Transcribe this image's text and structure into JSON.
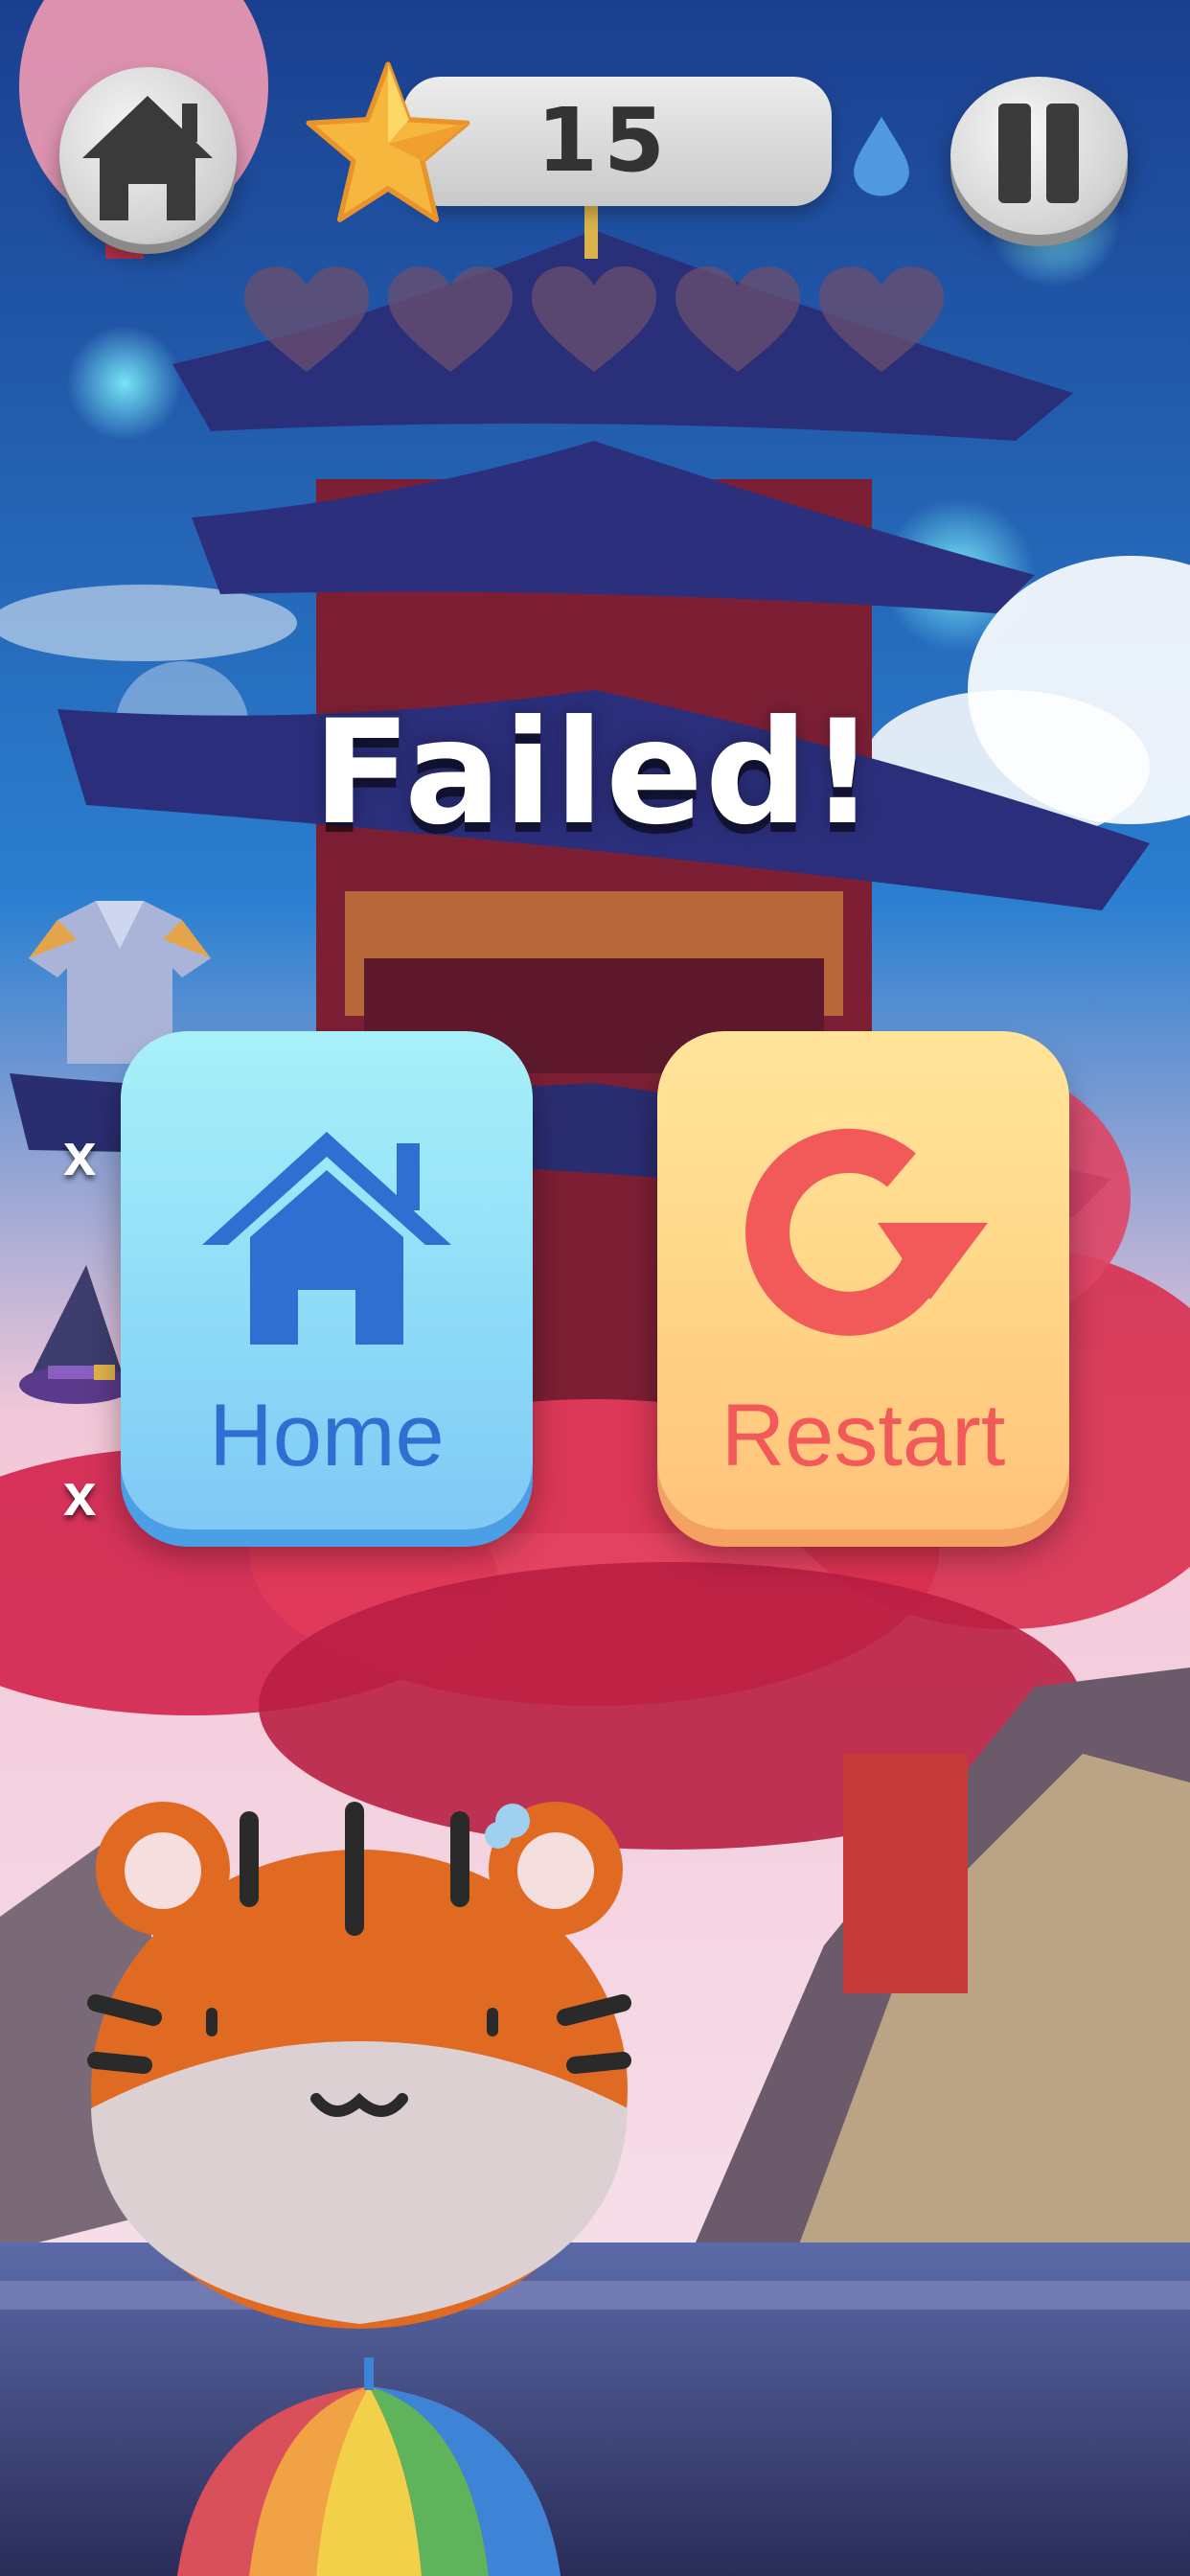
{
  "hud": {
    "score": "15",
    "home_icon": "house-icon",
    "star_icon": "star-icon",
    "drop_icon": "water-drop-icon",
    "pause_icon": "pause-icon",
    "lives_total": 5,
    "lives_remaining": 0
  },
  "dialog": {
    "title": "Failed!",
    "home_label": "Home",
    "restart_label": "Restart",
    "home_icon": "house-icon",
    "restart_icon": "restart-icon"
  },
  "inventory": {
    "items": [
      {
        "icon": "armor-icon",
        "count_prefix": "x"
      },
      {
        "icon": "wizard-hat-icon",
        "count_prefix": "x"
      }
    ]
  },
  "characters": {
    "player": "tiger-icon",
    "umbrella": "umbrella-icon"
  },
  "colors": {
    "home_tile": "#8fdcf8",
    "restart_tile": "#ffd587",
    "home_text": "#2f6fd1",
    "restart_text": "#f25a5a",
    "heart_empty": "#6b4f6e"
  }
}
